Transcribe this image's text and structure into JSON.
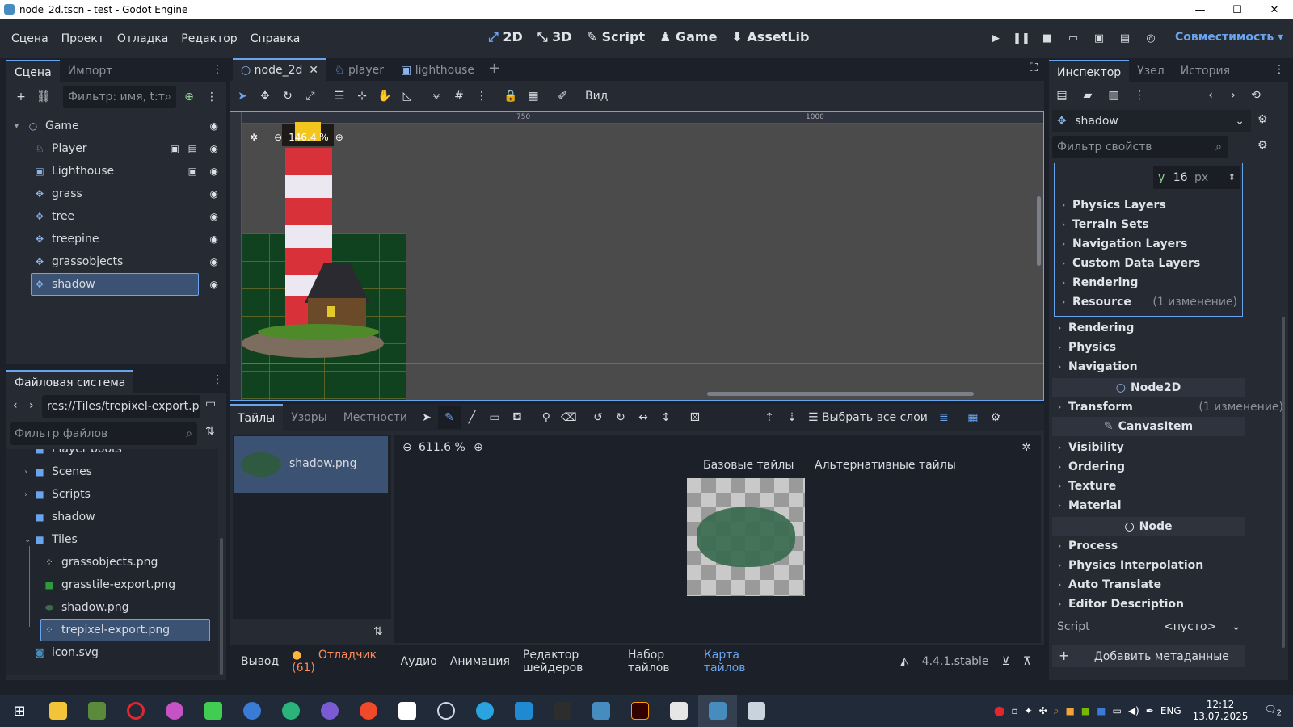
{
  "window": {
    "title": "node_2d.tscn - test - Godot Engine"
  },
  "menu": [
    "Сцена",
    "Проект",
    "Отладка",
    "Редактор",
    "Справка"
  ],
  "modes": {
    "m2d": "2D",
    "m3d": "3D",
    "script": "Script",
    "game": "Game",
    "assetlib": "AssetLib"
  },
  "compat": "Совместимость",
  "scene_panel": {
    "tab_scene": "Сцена",
    "tab_import": "Импорт",
    "filter_placeholder": "Фильтр: имя, t:т",
    "nodes": [
      {
        "name": "Game",
        "icon": "node-circle-icon"
      },
      {
        "name": "Player",
        "icon": "character-icon"
      },
      {
        "name": "Lighthouse",
        "icon": "staticbody-icon"
      },
      {
        "name": "grass",
        "icon": "tilemaplayer-icon"
      },
      {
        "name": "tree",
        "icon": "tilemaplayer-icon"
      },
      {
        "name": "treepine",
        "icon": "tilemaplayer-icon"
      },
      {
        "name": "grassobjects",
        "icon": "tilemaplayer-icon"
      },
      {
        "name": "shadow",
        "icon": "tilemaplayer-icon"
      }
    ]
  },
  "fs_panel": {
    "title": "Файловая система",
    "path": "res://Tiles/trepixel-export.p",
    "filter_placeholder": "Фильтр файлов",
    "items": [
      {
        "name": "Player boots",
        "kind": "folder"
      },
      {
        "name": "Scenes",
        "kind": "folder"
      },
      {
        "name": "Scripts",
        "kind": "folder"
      },
      {
        "name": "shadow",
        "kind": "folder"
      },
      {
        "name": "Tiles",
        "kind": "folder-open"
      },
      {
        "name": "grassobjects.png",
        "kind": "image"
      },
      {
        "name": "grasstile-export.png",
        "kind": "image"
      },
      {
        "name": "shadow.png",
        "kind": "image"
      },
      {
        "name": "trepixel-export.png",
        "kind": "image"
      },
      {
        "name": "icon.svg",
        "kind": "svg"
      }
    ]
  },
  "editor_tabs": [
    {
      "name": "node_2d",
      "icon": "node-circle-icon"
    },
    {
      "name": "player",
      "icon": "character-icon"
    },
    {
      "name": "lighthouse",
      "icon": "staticbody-icon"
    }
  ],
  "viewport": {
    "zoom": "146.4 %",
    "view_label": "Вид",
    "ruler_750": "750",
    "ruler_1000": "1000"
  },
  "tiles_panel": {
    "tab_tiles": "Тайлы",
    "tab_patterns": "Узоры",
    "tab_terrains": "Местности",
    "select_all_layers": "Выбрать все слои",
    "source": "shadow.png",
    "zoom": "611.6 %",
    "base_tiles": "Базовые тайлы",
    "alt_tiles": "Альтернативные тайлы"
  },
  "bottom_bar": {
    "output": "Вывод",
    "debugger": "Отладчик (61)",
    "audio": "Аудио",
    "animation": "Анимация",
    "shader_editor": "Редактор шейдеров",
    "tileset": "Набор тайлов",
    "tilemap": "Карта тайлов",
    "version": "4.4.1.stable"
  },
  "inspector": {
    "tab_inspector": "Инспектор",
    "tab_node": "Узел",
    "tab_history": "История",
    "object_name": "shadow",
    "filter_placeholder": "Фильтр свойств",
    "y_label": "y",
    "y_value": "16",
    "y_unit": "px",
    "tileset_sections": [
      "Physics Layers",
      "Terrain Sets",
      "Navigation Layers",
      "Custom Data Layers",
      "Rendering",
      "Resource"
    ],
    "resource_changes": "(1 изменение)",
    "layer_sections": [
      "Rendering",
      "Physics",
      "Navigation"
    ],
    "cat_node2d": "Node2D",
    "transform": "Transform",
    "transform_changes": "(1 изменение)",
    "cat_canvasitem": "CanvasItem",
    "canvas_sections": [
      "Visibility",
      "Ordering",
      "Texture",
      "Material"
    ],
    "cat_node": "Node",
    "node_sections": [
      "Process",
      "Physics Interpolation",
      "Auto Translate",
      "Editor Description"
    ],
    "script_label": "Script",
    "script_value": "<пусто>",
    "add_metadata": "Добавить метаданные"
  },
  "taskbar": {
    "lang": "ENG",
    "time": "12:12",
    "date": "13.07.2025",
    "notif": "2"
  }
}
